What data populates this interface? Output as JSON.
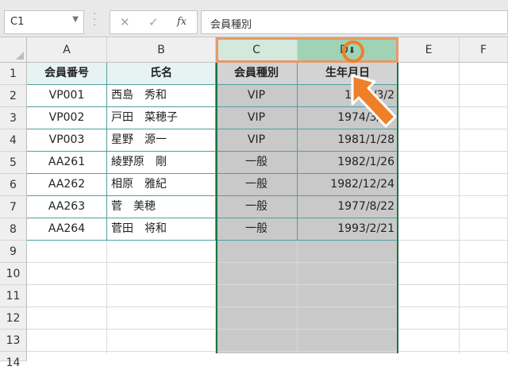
{
  "namebox": {
    "value": "C1"
  },
  "formula_bar": {
    "value": "会員種別",
    "fx_label": "fx",
    "cancel_glyph": "✕",
    "enter_glyph": "✓"
  },
  "columns": [
    "A",
    "B",
    "C",
    "D",
    "E",
    "F"
  ],
  "rows": [
    "1",
    "2",
    "3",
    "4",
    "5",
    "6",
    "7",
    "8",
    "9",
    "10",
    "11",
    "12",
    "13",
    "14"
  ],
  "table": {
    "headers": [
      "会員番号",
      "氏名",
      "会員種別",
      "生年月日"
    ],
    "data": [
      [
        "VP001",
        "西島　秀和",
        "VIP",
        "1971/3/2"
      ],
      [
        "VP002",
        "戸田　菜穂子",
        "VIP",
        "1974/3/13"
      ],
      [
        "VP003",
        "星野　源一",
        "VIP",
        "1981/1/28"
      ],
      [
        "AA261",
        "綾野原　剛",
        "一般",
        "1982/1/26"
      ],
      [
        "AA262",
        "相原　雅紀",
        "一般",
        "1982/12/24"
      ],
      [
        "AA263",
        "菅　美穂",
        "一般",
        "1977/8/22"
      ],
      [
        "AA264",
        "菅田　将和",
        "一般",
        "1993/2/21"
      ]
    ]
  },
  "colors": {
    "selection_border": "#217346",
    "highlight": "#e9986a",
    "arrow": "#f07f2a",
    "selected_fill": "#c9c9c9"
  }
}
